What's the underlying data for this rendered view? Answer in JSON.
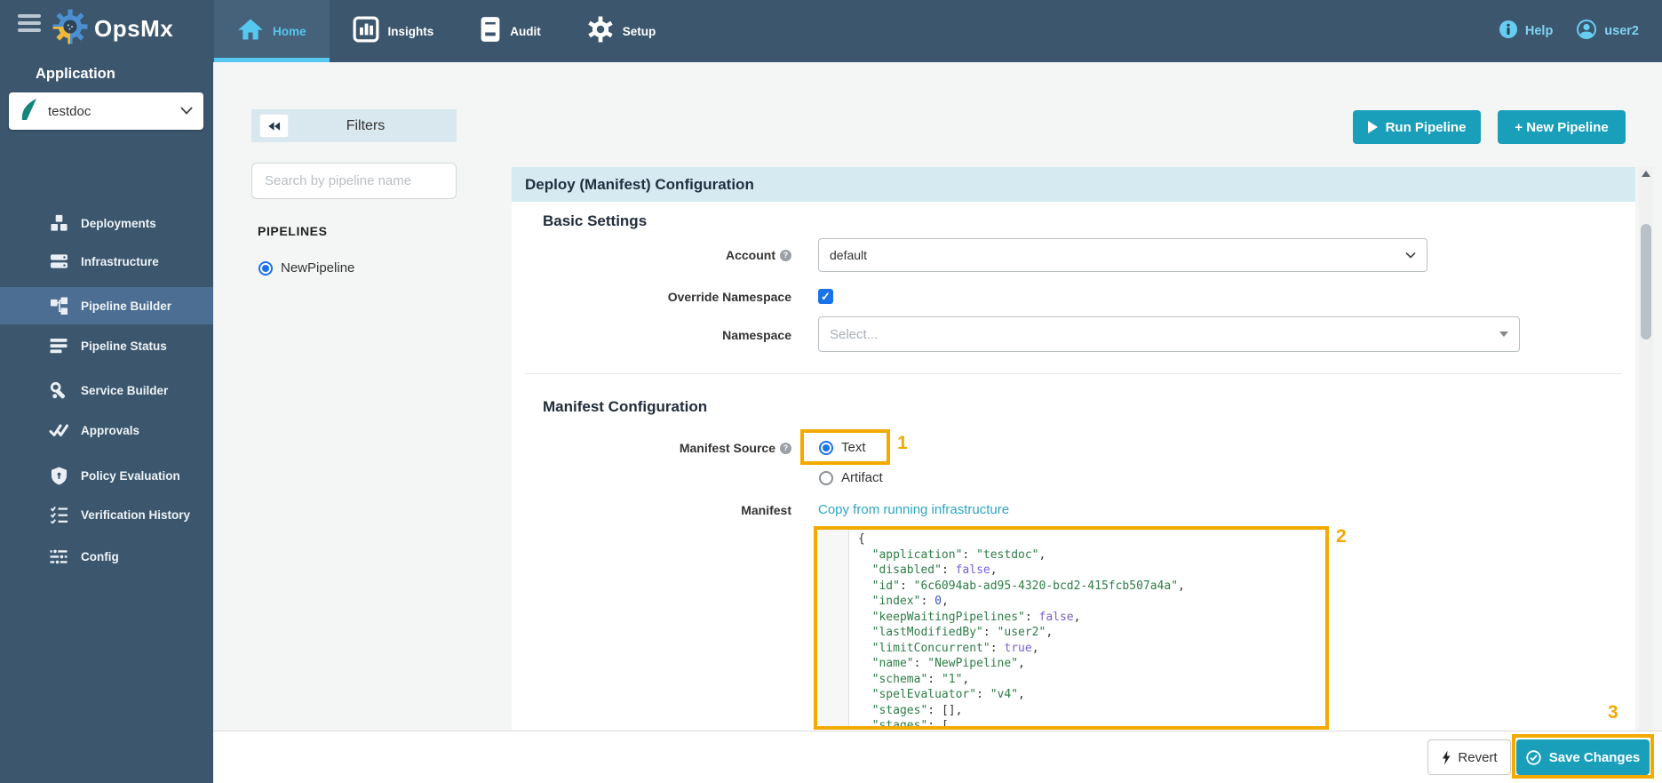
{
  "nav": {
    "brand": "OpsMx",
    "tabs": [
      {
        "label": "Home",
        "icon": "home-icon",
        "active": true
      },
      {
        "label": "Insights",
        "icon": "insights-icon",
        "active": false
      },
      {
        "label": "Audit",
        "icon": "audit-icon",
        "active": false
      },
      {
        "label": "Setup",
        "icon": "setup-icon",
        "active": false
      }
    ],
    "help_label": "Help",
    "user_label": "user2"
  },
  "sidebar": {
    "section_label": "Application",
    "selected_application": "testdoc",
    "items": [
      {
        "label": "Deployments",
        "icon": "deployments-icon",
        "selected": false
      },
      {
        "label": "Infrastructure",
        "icon": "infrastructure-icon",
        "selected": false
      },
      {
        "label": "Pipeline Builder",
        "icon": "pipeline-builder-icon",
        "selected": true
      },
      {
        "label": "Pipeline Status",
        "icon": "pipeline-status-icon",
        "selected": false
      },
      {
        "label": "Service Builder",
        "icon": "service-builder-icon",
        "selected": false
      },
      {
        "label": "Approvals",
        "icon": "approvals-icon",
        "selected": false
      },
      {
        "label": "Policy Evaluation",
        "icon": "policy-evaluation-icon",
        "selected": false
      },
      {
        "label": "Verification History",
        "icon": "verification-history-icon",
        "selected": false
      },
      {
        "label": "Config",
        "icon": "config-icon",
        "selected": false
      }
    ]
  },
  "filters": {
    "title": "Filters",
    "search_placeholder": "Search by pipeline name",
    "pipelines_heading": "PIPELINES",
    "pipelines": [
      {
        "name": "NewPipeline",
        "selected": true
      }
    ]
  },
  "actions": {
    "run_pipeline": "Run Pipeline",
    "new_pipeline": "+ New Pipeline"
  },
  "panel": {
    "title": "Deploy (Manifest) Configuration",
    "basic_settings": {
      "heading": "Basic Settings",
      "account_label": "Account",
      "account_value": "default",
      "override_namespace_label": "Override Namespace",
      "override_namespace_checked": true,
      "namespace_label": "Namespace",
      "namespace_placeholder": "Select..."
    },
    "manifest_configuration": {
      "heading": "Manifest Configuration",
      "source_label": "Manifest Source",
      "source_option_text": "Text",
      "source_option_artifact": "Artifact",
      "source_selected": "Text",
      "manifest_label": "Manifest",
      "copy_link": "Copy from running infrastructure"
    }
  },
  "manifest_editor": {
    "lines": [
      [
        {
          "t": "{",
          "c": "p"
        }
      ],
      [
        {
          "t": "  ",
          "c": "p"
        },
        {
          "t": "\"application\"",
          "c": "k"
        },
        {
          "t": ": ",
          "c": "p"
        },
        {
          "t": "\"testdoc\"",
          "c": "k"
        },
        {
          "t": ",",
          "c": "p"
        }
      ],
      [
        {
          "t": "  ",
          "c": "p"
        },
        {
          "t": "\"disabled\"",
          "c": "k"
        },
        {
          "t": ": ",
          "c": "p"
        },
        {
          "t": "false",
          "c": "a"
        },
        {
          "t": ",",
          "c": "p"
        }
      ],
      [
        {
          "t": "  ",
          "c": "p"
        },
        {
          "t": "\"id\"",
          "c": "k"
        },
        {
          "t": ": ",
          "c": "p"
        },
        {
          "t": "\"6c6094ab-ad95-4320-bcd2-415fcb507a4a\"",
          "c": "k"
        },
        {
          "t": ",",
          "c": "p"
        }
      ],
      [
        {
          "t": "  ",
          "c": "p"
        },
        {
          "t": "\"index\"",
          "c": "k"
        },
        {
          "t": ": ",
          "c": "p"
        },
        {
          "t": "0",
          "c": "n"
        },
        {
          "t": ",",
          "c": "p"
        }
      ],
      [
        {
          "t": "  ",
          "c": "p"
        },
        {
          "t": "\"keepWaitingPipelines\"",
          "c": "k"
        },
        {
          "t": ": ",
          "c": "p"
        },
        {
          "t": "false",
          "c": "a"
        },
        {
          "t": ",",
          "c": "p"
        }
      ],
      [
        {
          "t": "  ",
          "c": "p"
        },
        {
          "t": "\"lastModifiedBy\"",
          "c": "k"
        },
        {
          "t": ": ",
          "c": "p"
        },
        {
          "t": "\"user2\"",
          "c": "k"
        },
        {
          "t": ",",
          "c": "p"
        }
      ],
      [
        {
          "t": "  ",
          "c": "p"
        },
        {
          "t": "\"limitConcurrent\"",
          "c": "k"
        },
        {
          "t": ": ",
          "c": "p"
        },
        {
          "t": "true",
          "c": "a"
        },
        {
          "t": ",",
          "c": "p"
        }
      ],
      [
        {
          "t": "  ",
          "c": "p"
        },
        {
          "t": "\"name\"",
          "c": "k"
        },
        {
          "t": ": ",
          "c": "p"
        },
        {
          "t": "\"NewPipeline\"",
          "c": "k"
        },
        {
          "t": ",",
          "c": "p"
        }
      ],
      [
        {
          "t": "  ",
          "c": "p"
        },
        {
          "t": "\"schema\"",
          "c": "k"
        },
        {
          "t": ": ",
          "c": "p"
        },
        {
          "t": "\"1\"",
          "c": "k"
        },
        {
          "t": ",",
          "c": "p"
        }
      ],
      [
        {
          "t": "  ",
          "c": "p"
        },
        {
          "t": "\"spelEvaluator\"",
          "c": "k"
        },
        {
          "t": ": ",
          "c": "p"
        },
        {
          "t": "\"v4\"",
          "c": "k"
        },
        {
          "t": ",",
          "c": "p"
        }
      ],
      [
        {
          "t": "  ",
          "c": "p"
        },
        {
          "t": "\"stages\"",
          "c": "k"
        },
        {
          "t": ": ",
          "c": "p"
        },
        {
          "t": "[]",
          "c": "p"
        },
        {
          "t": ",",
          "c": "p"
        }
      ],
      [
        {
          "t": "  ",
          "c": "p"
        },
        {
          "t": "\"stages\"",
          "c": "k"
        },
        {
          "t": ": ",
          "c": "p"
        },
        {
          "t": "[",
          "c": "p"
        }
      ]
    ]
  },
  "annotations": {
    "step1": "1",
    "step2": "2",
    "step3": "3",
    "highlight_color": "#f2a900"
  },
  "footer": {
    "revert_label": "Revert",
    "save_label": "Save Changes"
  },
  "colors": {
    "navbar_bg": "#3b566d",
    "active_tab_bg": "#46627b",
    "accent_cyan": "#56c7ee",
    "selected_item_bg": "#4c6e92",
    "teal_button": "#1a9fbb",
    "panel_header_bg": "#d6eaf2",
    "link_teal": "#2aa7c5",
    "highlight_orange": "#f2a900"
  }
}
